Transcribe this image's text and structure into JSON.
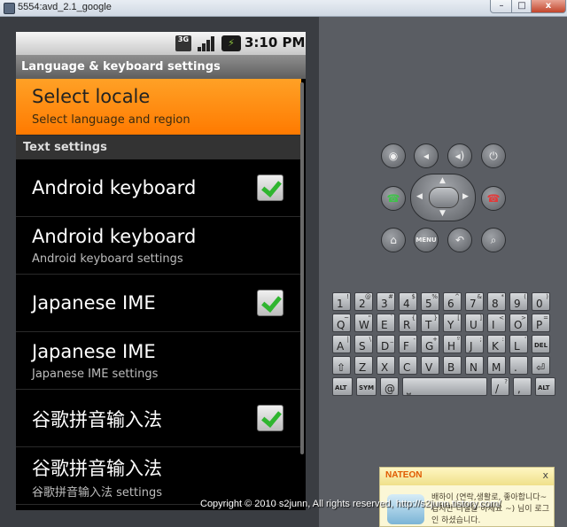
{
  "window": {
    "title": "5554:avd_2.1_google",
    "minimize_glyph": "–",
    "maximize_glyph": "□",
    "close_glyph": "x"
  },
  "statusbar": {
    "network": "3G",
    "time": "3:10 PM"
  },
  "app_title": "Language & keyboard settings",
  "items": {
    "locale": {
      "title": "Select locale",
      "summary": "Select language and region"
    },
    "category": "Text settings",
    "android_kb": {
      "title": "Android keyboard",
      "checked": true
    },
    "android_kb_settings": {
      "title": "Android keyboard",
      "summary": "Android keyboard settings"
    },
    "japanese_ime": {
      "title": "Japanese IME",
      "checked": true
    },
    "japanese_ime_settings": {
      "title": "Japanese IME",
      "summary": "Japanese IME settings"
    },
    "pinyin": {
      "title": "谷歌拼音输入法",
      "checked": true
    },
    "pinyin_settings": {
      "title": "谷歌拼音输入法",
      "summary": "谷歌拼音输入法 settings"
    }
  },
  "controls": {
    "camera": "◉",
    "vol_down": "◂",
    "vol_up": "◂)",
    "power": "⏻",
    "call": "☎",
    "end": "☎",
    "home": "⌂",
    "menu": "MENU",
    "back": "↶",
    "search": "⌕",
    "dpad_up": "▲",
    "dpad_down": "▼",
    "dpad_left": "◀",
    "dpad_right": "▶"
  },
  "keyboard": {
    "row1": [
      [
        "1",
        "!"
      ],
      [
        "2",
        "@"
      ],
      [
        "3",
        "#"
      ],
      [
        "4",
        "$"
      ],
      [
        "5",
        "%"
      ],
      [
        "6",
        "^"
      ],
      [
        "7",
        "&"
      ],
      [
        "8",
        "*"
      ],
      [
        "9",
        "("
      ],
      [
        "0",
        ")"
      ]
    ],
    "row2": [
      [
        "Q",
        "~"
      ],
      [
        "W",
        "\""
      ],
      [
        "E",
        "`"
      ],
      [
        "R",
        "{"
      ],
      [
        "T",
        "}"
      ],
      [
        "Y",
        "["
      ],
      [
        "U",
        "]"
      ],
      [
        "I",
        "<"
      ],
      [
        "O",
        ">"
      ],
      [
        "P",
        "="
      ]
    ],
    "row3": [
      [
        "A",
        "|"
      ],
      [
        "S",
        "\\"
      ],
      [
        "D",
        "_"
      ],
      [
        "F",
        "-"
      ],
      [
        "G",
        "+"
      ],
      [
        "H",
        "º"
      ],
      [
        "J",
        ";"
      ],
      [
        "K",
        ":"
      ],
      [
        "L",
        "'"
      ],
      [
        "DEL",
        ""
      ]
    ],
    "row4": [
      [
        "⇧",
        ""
      ],
      [
        "Z",
        ""
      ],
      [
        "X",
        ""
      ],
      [
        "C",
        ""
      ],
      [
        "V",
        ""
      ],
      [
        "B",
        ""
      ],
      [
        "N",
        ""
      ],
      [
        "M",
        ""
      ],
      [
        ".",
        ""
      ],
      [
        "⏎",
        ""
      ]
    ],
    "row5": [
      [
        "ALT",
        ""
      ],
      [
        "SYM",
        ""
      ],
      [
        "@",
        ""
      ],
      [
        "⎵",
        ""
      ],
      [
        "/",
        "?"
      ],
      [
        ",",
        ""
      ],
      [
        "ALT",
        ""
      ]
    ]
  },
  "notification": {
    "brand": "NATEON",
    "close": "x",
    "message": "배하이 (연락,생활로, 좋아합니다~ 컵지만 디절을 아세요 ~) 님이 로그인 하셨습니다."
  },
  "copyright": "Copyright © 2010 s2junn, All rights reserved, http://s2junn.tistory.com/"
}
